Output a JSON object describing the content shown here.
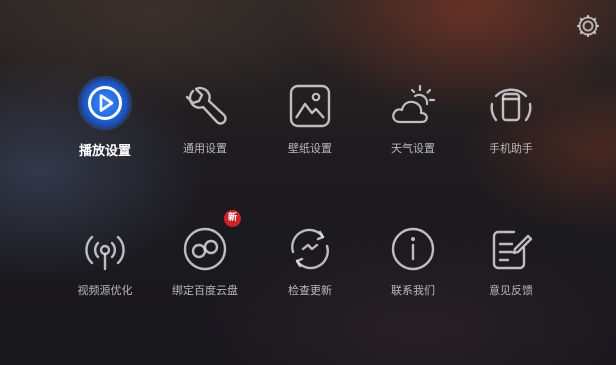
{
  "topbar": {
    "settings_icon": "gear-icon"
  },
  "menu": {
    "active_color": "#2f7ff0",
    "row1": [
      {
        "label": "播放设置",
        "icon": "play-circle-icon",
        "active": true
      },
      {
        "label": "通用设置",
        "icon": "wrench-icon"
      },
      {
        "label": "壁纸设置",
        "icon": "picture-icon"
      },
      {
        "label": "天气设置",
        "icon": "weather-icon"
      },
      {
        "label": "手机助手",
        "icon": "phone-icon"
      }
    ],
    "row2": [
      {
        "label": "视频源优化",
        "icon": "signal-icon"
      },
      {
        "label": "绑定百度云盘",
        "icon": "cloud-link-icon",
        "badge": "新"
      },
      {
        "label": "检查更新",
        "icon": "refresh-icon"
      },
      {
        "label": "联系我们",
        "icon": "info-icon"
      },
      {
        "label": "意见反馈",
        "icon": "feedback-icon"
      }
    ]
  }
}
